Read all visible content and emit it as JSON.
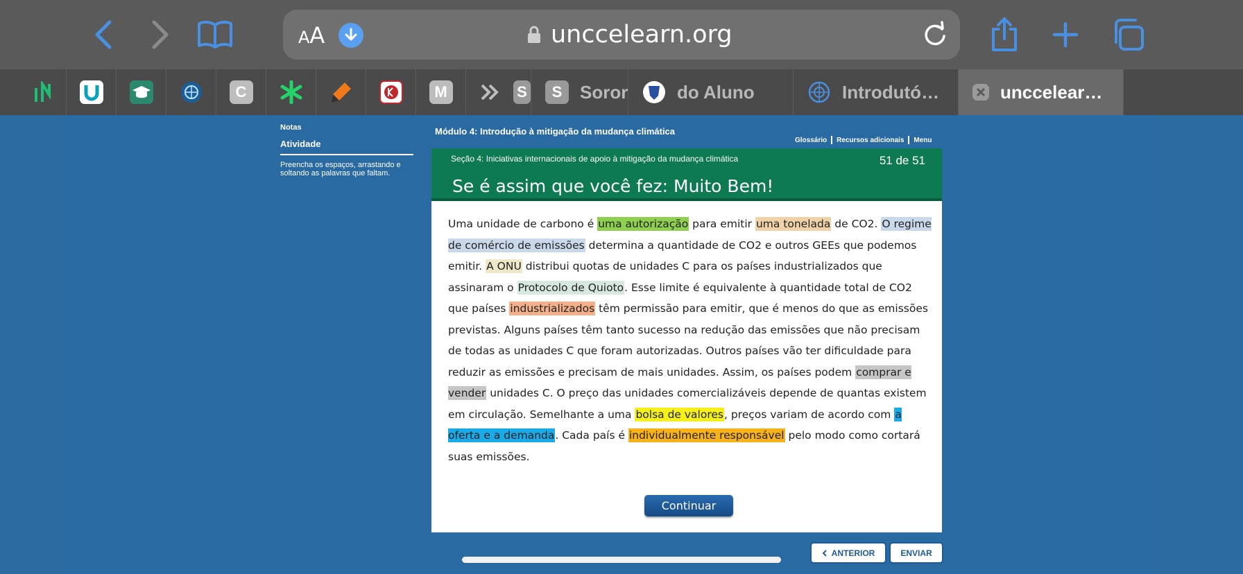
{
  "browser": {
    "aa_small": "A",
    "aa_large": "A",
    "url": "unccelearn.org",
    "tabs": [
      {
        "label": "Sorori"
      },
      {
        "label": "do Aluno"
      },
      {
        "label": "Introdutó…"
      },
      {
        "label": "unccelear…"
      }
    ],
    "pinned": [
      {
        "letter": "C"
      },
      {
        "letter": "M"
      },
      {
        "letter": "S"
      },
      {
        "letter": "S"
      }
    ]
  },
  "sidebar": {
    "notes_label": "Notas",
    "activity_label": "Atividade",
    "instructions": "Preencha os espaços, arrastando e soltando as palavras que faltam."
  },
  "module": {
    "title": "Módulo 4: Introdução à mitigação da mudança climática",
    "links": [
      "Glossário",
      "Recursos adicionais",
      "Menu"
    ]
  },
  "slide": {
    "section": "Seção 4: Iniciativas internacionais de apoio à mitigação da mudança climática",
    "count": "51 de 51",
    "title": "Se é assim que você fez: Muito Bem!",
    "paragraph": [
      {
        "t": "Uma unidade de carbono é "
      },
      {
        "t": "uma autorização",
        "hl": "#8fd14f"
      },
      {
        "t": "  para emitir "
      },
      {
        "t": "uma tonelada",
        "hl": "#f0d2a8"
      },
      {
        "t": " de CO2. "
      },
      {
        "t": "O regime de comércio de emissões",
        "hl": "#c9d9ea"
      },
      {
        "t": "   determina a quantidade de CO2 e outros GEEs que podemos emitir. "
      },
      {
        "t": "A ONU",
        "hl": "#eee8c8"
      },
      {
        "t": "  distribui quotas de unidades C para os países industrializados que assinaram o "
      },
      {
        "t": "Protocolo de Quioto",
        "hl": "#d7e8e0"
      },
      {
        "t": ". Esse limite é equivalente à quantidade total de CO2 que países "
      },
      {
        "t": "industrializados",
        "hl": "#f4b08a"
      },
      {
        "t": " têm permissão para emitir, que é menos do que as emissões previstas. Alguns países têm tanto sucesso na redução das emissões que não precisam de todas as unidades C que foram autorizadas. Outros países vão ter dificuldade para reduzir as emissões e precisam de mais unidades. Assim, os países podem "
      },
      {
        "t": "comprar e vender",
        "hl": "#c6c6c6"
      },
      {
        "t": " unidades C. O preço das unidades comercializáveis depende de quantas existem em circulação. Semelhante a uma "
      },
      {
        "t": "bolsa de valores",
        "hl": "#f5f01a"
      },
      {
        "t": ", preços variam de acordo com "
      },
      {
        "t": "a oferta e a demanda",
        "hl": "#1aaae8"
      },
      {
        "t": ". Cada país é "
      },
      {
        "t": "individualmente responsável",
        "hl": "#f7b21a"
      },
      {
        "t": " pelo modo como cortará suas emissões."
      }
    ],
    "continue_label": "Continuar"
  },
  "footer": {
    "prev_label": "ANTERIOR",
    "submit_label": "ENVIAR"
  }
}
